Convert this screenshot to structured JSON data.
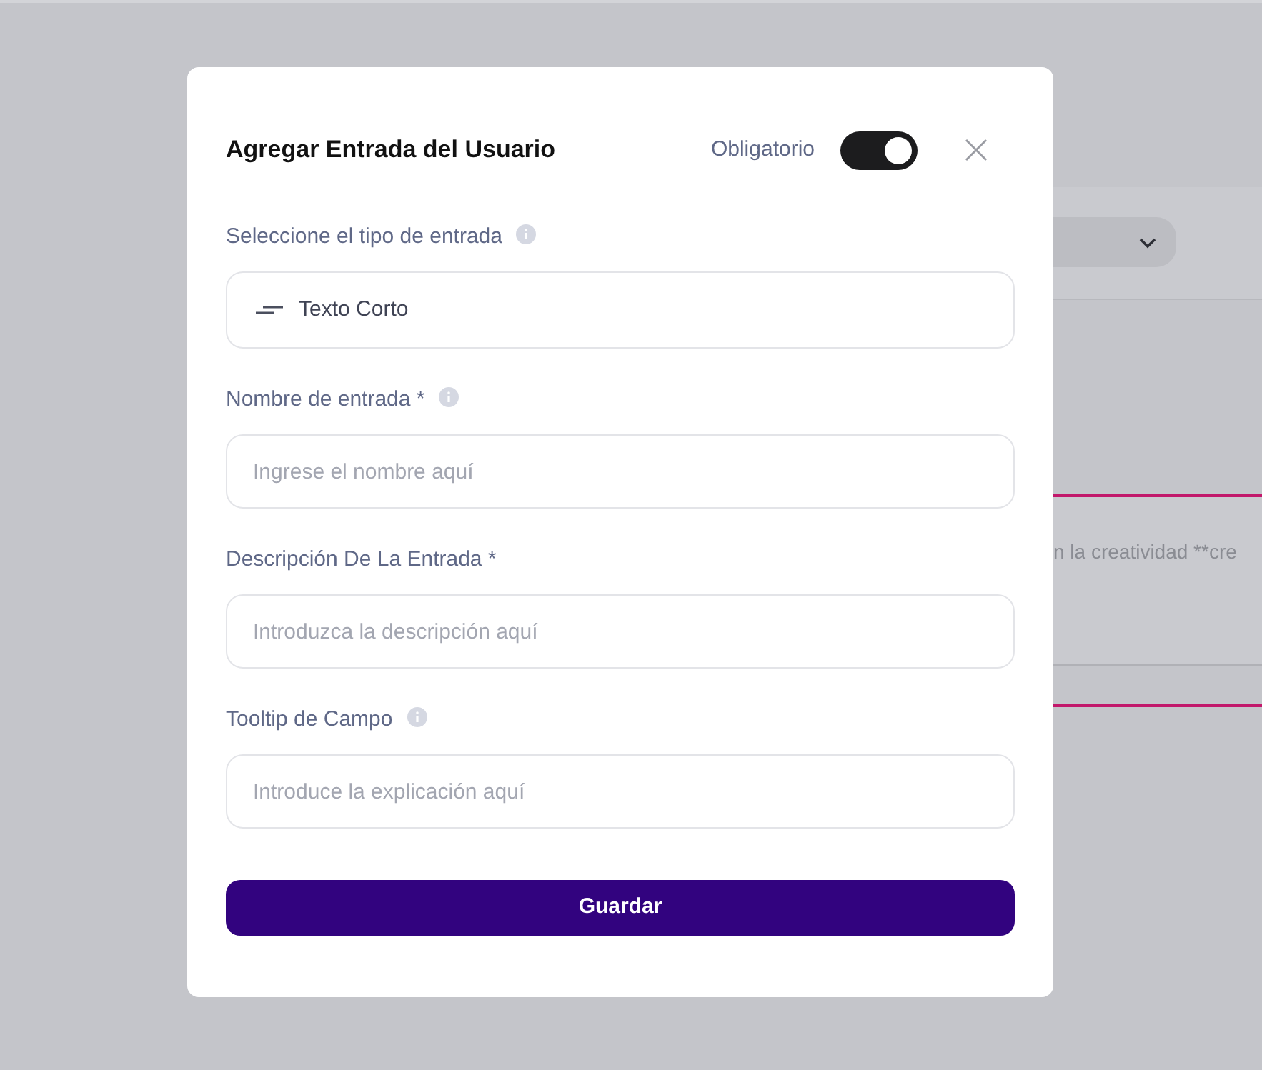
{
  "background": {
    "snippet": "n la creatividad **cre"
  },
  "modal": {
    "title": "Agregar Entrada del Usuario",
    "required_toggle": {
      "label": "Obligatorio",
      "on": true
    },
    "fields": [
      {
        "kind": "select",
        "label": "Seleccione el tipo de entrada",
        "info_icon": true,
        "value": "Texto Corto"
      },
      {
        "kind": "input",
        "label": "Nombre de entrada *",
        "info_icon": true,
        "placeholder": "Ingrese el nombre aquí"
      },
      {
        "kind": "input",
        "label": "Descripción De La Entrada *",
        "info_icon": false,
        "placeholder": "Introduzca la descripción aquí"
      },
      {
        "kind": "input",
        "label": "Tooltip de Campo",
        "info_icon": true,
        "placeholder": "Introduce la explicación aquí"
      }
    ],
    "save_button": "Guardar"
  }
}
